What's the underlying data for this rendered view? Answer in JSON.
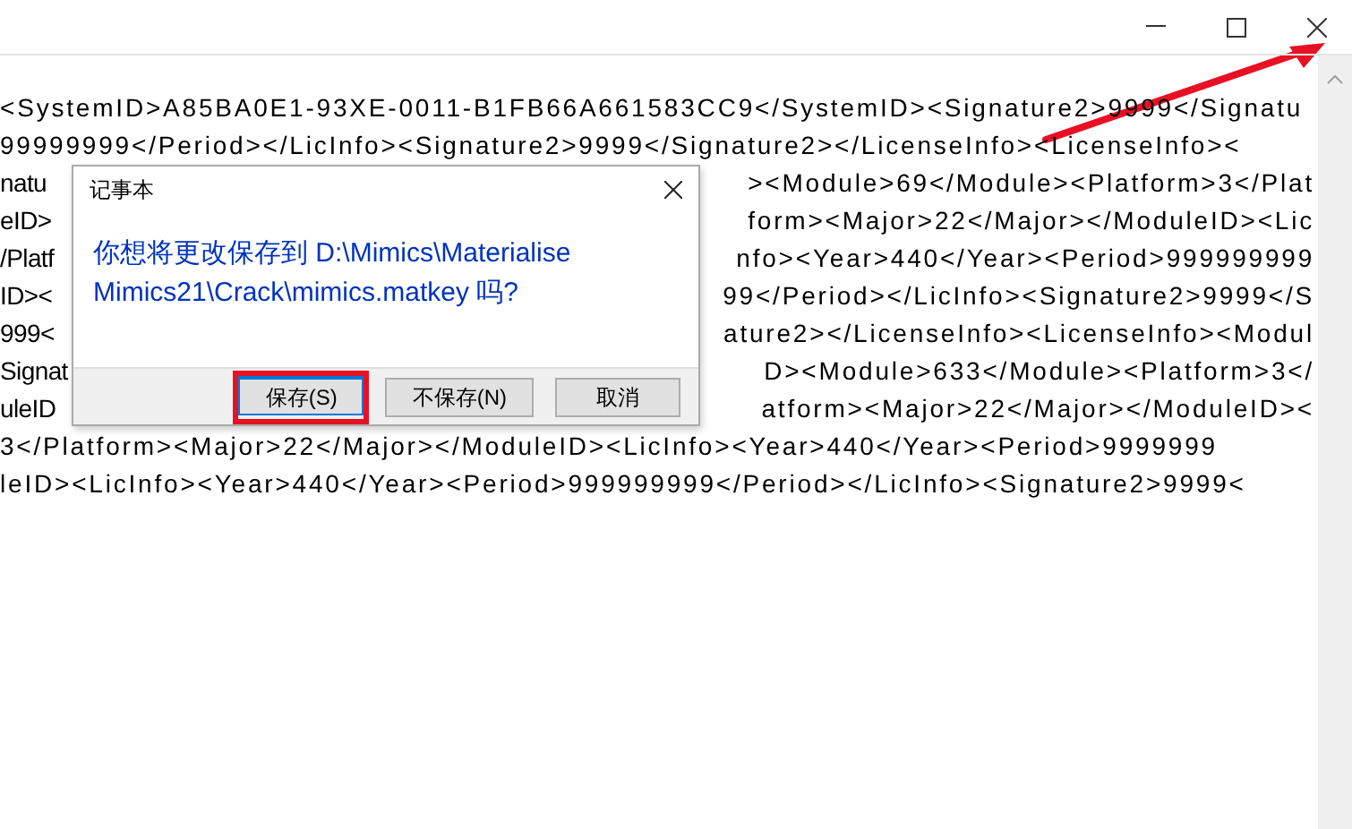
{
  "lines": [
    {
      "left": "<SystemID>A85BA0E1-93XE-0011-B1FB66A661583CC9</SystemID><Signature2>9999</Signatu"
    },
    {
      "left": "99999999</Period></LicInfo><Signature2>9999</Signature2></LicenseInfo><LicenseInfo><"
    },
    {
      "left": "natu",
      "right": "><Module>69</Module><Platform>3</Plat"
    },
    {
      "left": "eID>",
      "right": "form><Major>22</Major></ModuleID><Lic"
    },
    {
      "left": "/Platf",
      "right": "nfo><Year>440</Year><Period>999999999"
    },
    {
      "left": "ID><",
      "right": "99</Period></LicInfo><Signature2>9999</S"
    },
    {
      "left": "999<",
      "right": "ature2></LicenseInfo><LicenseInfo><Modul"
    },
    {
      "left": "Signat",
      "right": "D><Module>633</Module><Platform>3</"
    },
    {
      "left": "uleID",
      "right": "atform><Major>22</Major></ModuleID><"
    },
    {
      "left": "3</Platform><Major>22</Major></ModuleID><LicInfo><Year>440</Year><Period>9999999"
    },
    {
      "left": "leID><LicInfo><Year>440</Year><Period>999999999</Period></LicInfo><Signature2>9999<"
    }
  ],
  "dialog": {
    "title": "记事本",
    "message": "你想将更改保存到 D:\\Mimics\\Materialise Mimics21\\Crack\\mimics.matkey 吗?",
    "buttons": [
      {
        "label": "保存(S)",
        "focused": true,
        "marked": true
      },
      {
        "label": "不保存(N)",
        "focused": false,
        "marked": false
      },
      {
        "label": "取消",
        "focused": false,
        "marked": false
      }
    ]
  }
}
